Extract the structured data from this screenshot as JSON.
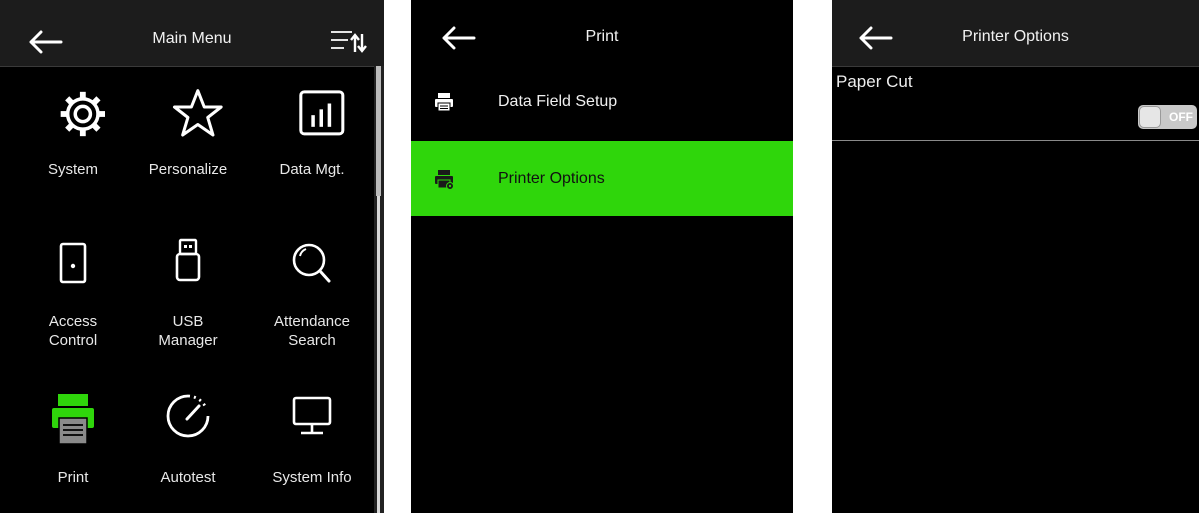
{
  "main_menu": {
    "title": "Main Menu",
    "items": [
      {
        "label": "System",
        "icon": "gear-icon"
      },
      {
        "label": "Personalize",
        "icon": "star-icon"
      },
      {
        "label": "Data Mgt.",
        "icon": "bar-chart-icon"
      },
      {
        "label": "Access\nControl",
        "icon": "door-icon"
      },
      {
        "label": "USB\nManager",
        "icon": "usb-icon"
      },
      {
        "label": "Attendance\nSearch",
        "icon": "magnifier-icon"
      },
      {
        "label": "Print",
        "icon": "printer-icon"
      },
      {
        "label": "Autotest",
        "icon": "gauge-icon"
      },
      {
        "label": "System Info",
        "icon": "monitor-icon"
      }
    ]
  },
  "print_menu": {
    "title": "Print",
    "items": [
      {
        "label": "Data Field Setup",
        "icon": "printer-icon"
      },
      {
        "label": "Printer Options",
        "icon": "printer-settings-icon"
      }
    ]
  },
  "printer_options": {
    "title": "Printer Options",
    "paper_cut_label": "Paper Cut",
    "paper_cut_state": "OFF"
  },
  "colors": {
    "accent": "#2fd60b",
    "background": "#000000",
    "titlebar": "#1c1c1c"
  }
}
